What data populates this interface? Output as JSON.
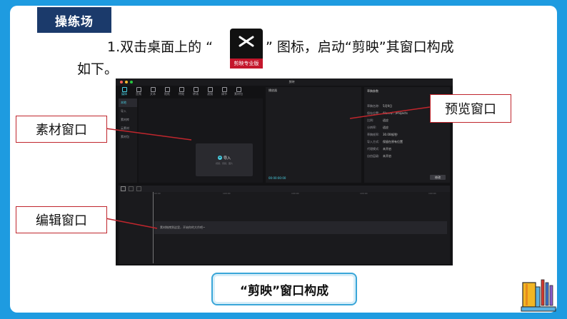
{
  "slide": {
    "badge": "操练场",
    "instruction_prefix": "1.双击桌面上的 “",
    "instruction_suffix": "” 图标，启动“剪映”其窗口构成",
    "instruction_line2": "如下。",
    "caption": "“剪映”窗口构成"
  },
  "capcut_icon": {
    "label": "剪映专业版"
  },
  "app": {
    "window_title": "剪映",
    "toolbar": [
      {
        "label": "媒体",
        "icon": "media-icon",
        "active": true
      },
      {
        "label": "音频",
        "icon": "audio-icon"
      },
      {
        "label": "文本",
        "icon": "text-icon"
      },
      {
        "label": "贴纸",
        "icon": "sticker-icon"
      },
      {
        "label": "特效",
        "icon": "effects-icon"
      },
      {
        "label": "转场",
        "icon": "transition-icon"
      },
      {
        "label": "滤镜",
        "icon": "filter-icon"
      },
      {
        "label": "调节",
        "icon": "adjust-icon"
      },
      {
        "label": "素材包",
        "icon": "package-icon"
      }
    ],
    "left_nav": [
      {
        "label": "本地",
        "active": true
      },
      {
        "label": "导入"
      },
      {
        "label": "素材库"
      },
      {
        "label": "云素材"
      },
      {
        "label": "素材包"
      }
    ],
    "import_label": "导入",
    "import_hint": "视频、音频、图片",
    "player_title": "播放器",
    "player_time": "00:00:00:00",
    "props_title": "草稿参数",
    "props": [
      {
        "k": "草稿名称:",
        "v": "5月9日"
      },
      {
        "k": "保存位置:",
        "v": "/Users/.../Projects"
      },
      {
        "k": "比例:",
        "v": "适应"
      },
      {
        "k": "分辨率:",
        "v": "适应"
      },
      {
        "k": "草稿帧率:",
        "v": "30.00帧/秒"
      },
      {
        "k": "导入方式:",
        "v": "保留在原有位置"
      },
      {
        "k": "代理模式:",
        "v": "未开启"
      },
      {
        "k": "自由层级:",
        "v": "未开启"
      }
    ],
    "modify_label": "修改",
    "timeline_hint": "素材拖拽到这里，开始你的大作吧~",
    "ruler_marks": [
      "00:00",
      "100:00",
      "100:00",
      "100:00",
      "100:00"
    ]
  },
  "callouts": {
    "material": "素材窗口",
    "preview": "预览窗口",
    "editor": "编辑窗口"
  },
  "colors": {
    "slide_bg": "#1e9be0",
    "badge": "#1b3a6b",
    "callout_border": "#c0262d",
    "accent": "#4ad2e6"
  }
}
